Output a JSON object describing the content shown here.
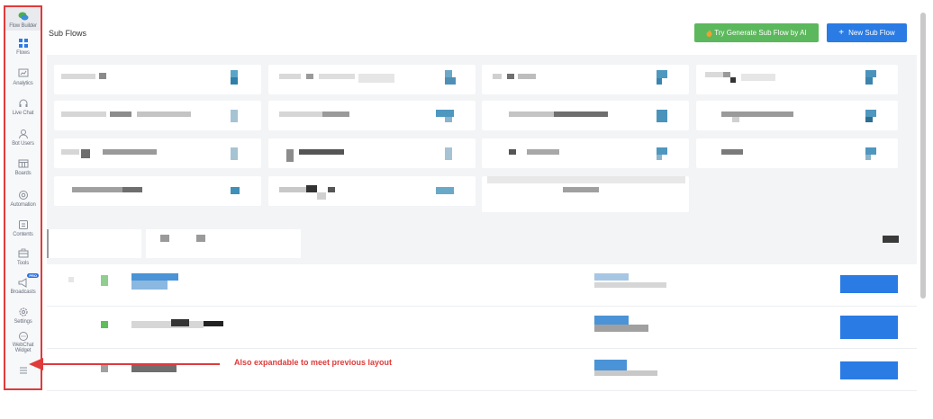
{
  "sidebar": {
    "items": [
      {
        "label": "Flow Builder",
        "icon": "chat-bubbles-icon"
      },
      {
        "label": "Flows",
        "icon": "grid-icon"
      },
      {
        "label": "Analytics",
        "icon": "analytics-icon"
      },
      {
        "label": "Live Chat",
        "icon": "headset-icon"
      },
      {
        "label": "Bot Users",
        "icon": "user-icon"
      },
      {
        "label": "Boards",
        "icon": "board-icon"
      },
      {
        "label": "Automation",
        "icon": "automation-icon"
      },
      {
        "label": "Contents",
        "icon": "contents-icon"
      },
      {
        "label": "Tools",
        "icon": "toolbox-icon"
      },
      {
        "label": "Broadcasts",
        "icon": "megaphone-icon",
        "badge": "PRO"
      },
      {
        "label": "Settings",
        "icon": "gear-icon"
      },
      {
        "label": "WebChat Widget",
        "icon": "webchat-icon"
      }
    ],
    "expand_icon": "hamburger-icon"
  },
  "header": {
    "title": "Sub Flows",
    "ai_button": {
      "label": "Try Generate Sub Flow by AI",
      "icon": "fire-icon",
      "color": "#5cb85c"
    },
    "new_button": {
      "label": "New Sub Flow",
      "icon": "plus-icon",
      "color": "#2a7be4"
    }
  },
  "annotation": {
    "text": "Also expandable to meet previous layout",
    "color": "#e03a3a"
  }
}
